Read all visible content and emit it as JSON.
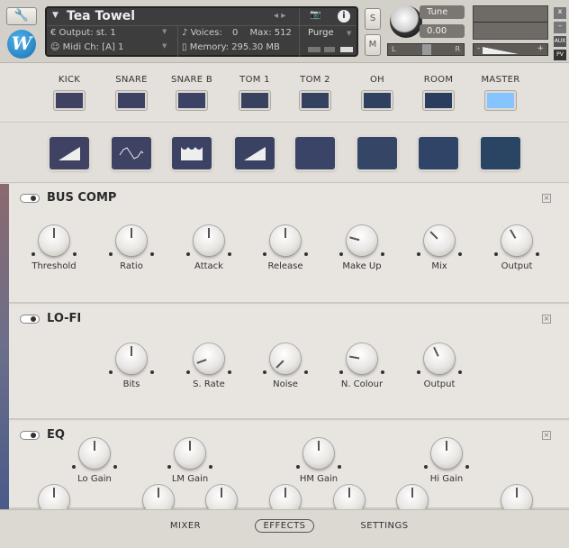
{
  "header": {
    "title": "Tea Towel",
    "output_label": "Output:",
    "output_value": "st. 1",
    "midi_label": "Midi Ch:",
    "midi_value": "[A] 1",
    "voices_label": "Voices:",
    "voices_value": "0",
    "max_label": "Max:",
    "max_value": "512",
    "memory_label": "Memory:",
    "memory_value": "295.30 MB",
    "purge": "Purge",
    "solo": "S",
    "mute": "M",
    "tune_label": "Tune",
    "tune_value": "0.00",
    "pan_l": "L",
    "pan_r": "R",
    "aux": "AUX",
    "pv": "PV",
    "close": "x",
    "minimize": "–",
    "vol_minus": "-",
    "vol_plus": "+"
  },
  "channels": [
    {
      "label": "KICK",
      "color": "#3f4260"
    },
    {
      "label": "SNARE",
      "color": "#3d4262"
    },
    {
      "label": "SNARE B",
      "color": "#3b4263"
    },
    {
      "label": "TOM 1",
      "color": "#38425f"
    },
    {
      "label": "TOM 2",
      "color": "#344260"
    },
    {
      "label": "OH",
      "color": "#2f4060"
    },
    {
      "label": "ROOM",
      "color": "#2a3d5e"
    },
    {
      "label": "MASTER",
      "color": "#86c4ff"
    }
  ],
  "slots": [
    {
      "icon": "compressor-icon",
      "color": "#3f4262"
    },
    {
      "icon": "lofi-wave-icon",
      "color": "#3e4263"
    },
    {
      "icon": "eq-icon",
      "color": "#3c4263"
    },
    {
      "icon": "compressor-icon",
      "color": "#394262"
    },
    {
      "icon": "empty",
      "color": "#3a4466"
    },
    {
      "icon": "empty",
      "color": "#344566"
    },
    {
      "icon": "empty",
      "color": "#2f4466"
    },
    {
      "icon": "empty",
      "color": "#2a4464"
    }
  ],
  "sections": [
    {
      "title": "BUS COMP",
      "knobs": [
        {
          "label": "Threshold",
          "angle": 0
        },
        {
          "label": "Ratio",
          "angle": 0
        },
        {
          "label": "Attack",
          "angle": 0
        },
        {
          "label": "Release",
          "angle": 0
        },
        {
          "label": "Make Up",
          "angle": -75
        },
        {
          "label": "Mix",
          "angle": -45
        },
        {
          "label": "Output",
          "angle": -30
        }
      ]
    },
    {
      "title": "LO-FI",
      "knobs": [
        {
          "label": "Bits",
          "angle": 0
        },
        {
          "label": "S. Rate",
          "angle": -110
        },
        {
          "label": "Noise",
          "angle": -135
        },
        {
          "label": "N. Colour",
          "angle": -80
        },
        {
          "label": "Output",
          "angle": -25
        }
      ]
    },
    {
      "title": "EQ",
      "knobs": [
        {
          "label": "Lo Gain",
          "angle": 0
        },
        {
          "label": "LM Gain",
          "angle": 0
        },
        {
          "label": "HM Gain",
          "angle": 0
        },
        {
          "label": "Hi Gain",
          "angle": 0
        }
      ]
    }
  ],
  "footer": {
    "tabs": [
      "MIXER",
      "EFFECTS",
      "SETTINGS"
    ],
    "active": "EFFECTS"
  }
}
